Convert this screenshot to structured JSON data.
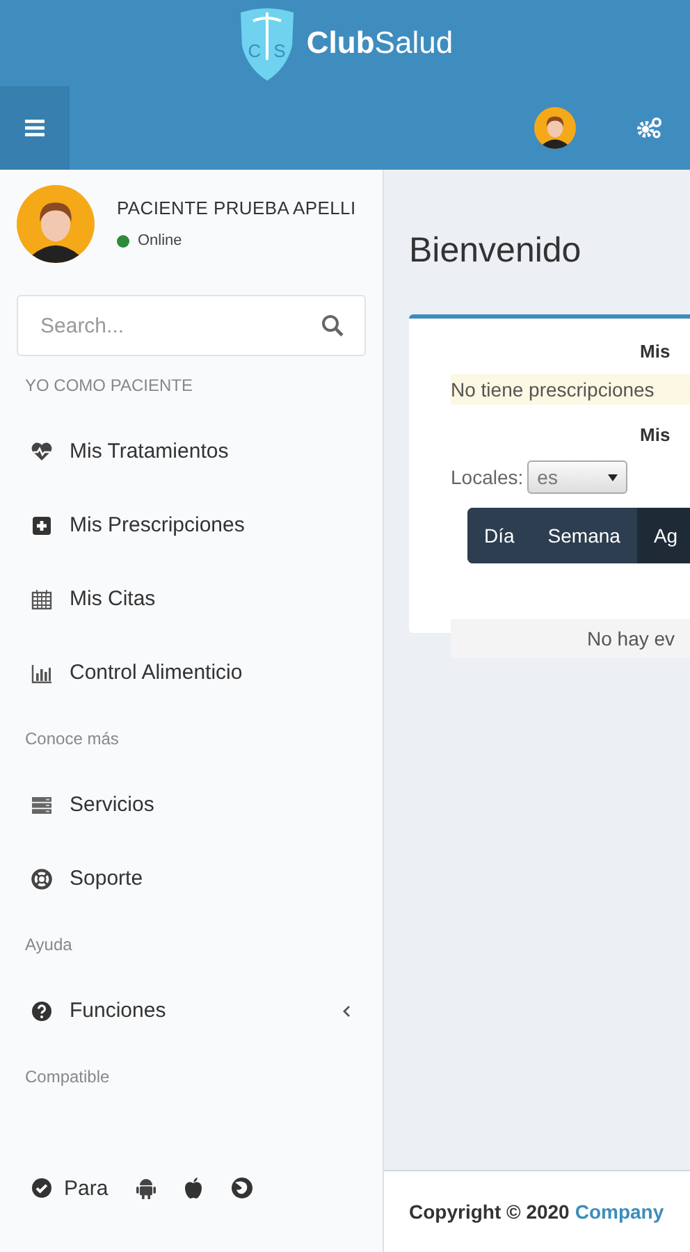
{
  "header": {
    "initials": [
      "C",
      "S"
    ],
    "brand": "**Club**Salud"
  },
  "user": {
    "name": "PACIENTE PRUEBA APELLI",
    "status": "Online",
    "online": true
  },
  "search": {
    "placeholder": "Search..."
  },
  "sidebar": {
    "sections": [
      {
        "title": "YO COMO PACIENTE",
        "items": [
          {
            "label": "Mis Tratamientos"
          },
          {
            "label": "Mis Prescripciones"
          },
          {
            "label": "Mis Citas"
          },
          {
            "label": "Control Alimenticio"
          }
        ]
      },
      {
        "title": "Conoce más",
        "items": [
          {
            "label": "Servicios"
          },
          {
            "label": "Soporte"
          }
        ]
      },
      {
        "title": "Ayuda",
        "items": [
          {
            "label": "Funciones",
            "expanded": false
          }
        ]
      },
      {
        "title": "Compatible"
      }
    ],
    "platforms_label": "Para"
  },
  "main": {
    "title": "Bienvenido",
    "card": {
      "heading_1": "Mis",
      "notice": "No tiene prescripciones",
      "heading_2": "Mis",
      "locale_label": "Locales:",
      "locale_value": "es",
      "view_tabs": [
        {
          "label": "Día",
          "selected": false
        },
        {
          "label": "Semana",
          "selected": false
        },
        {
          "label": "Ag",
          "selected": true
        }
      ],
      "empty": "No hay ev"
    }
  },
  "footer": {
    "text": "Copyright © 2020",
    "link": "Company"
  }
}
